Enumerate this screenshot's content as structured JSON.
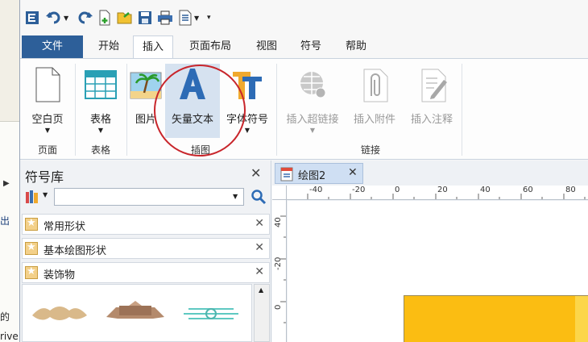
{
  "colors": {
    "file_tab": "#2d5f99",
    "highlight_circle": "#c8252b",
    "page_fill": "#fbbd12"
  },
  "background": {
    "text1": "出",
    "text2": "的",
    "text3": "rive"
  },
  "qat": {
    "icons": [
      "app-logo-icon",
      "undo-icon",
      "redo-icon",
      "new-icon",
      "open-icon",
      "save-icon",
      "print-icon",
      "export-icon",
      "customize-icon"
    ]
  },
  "tabs": [
    {
      "label": "文件"
    },
    {
      "label": "开始"
    },
    {
      "label": "插入"
    },
    {
      "label": "页面布局"
    },
    {
      "label": "视图"
    },
    {
      "label": "符号"
    },
    {
      "label": "帮助"
    }
  ],
  "ribbon": {
    "blank_page": "空白页",
    "table": "表格",
    "picture": "图片",
    "vector_text": "矢量文本",
    "font_symbol": "字体符号",
    "hyperlink": "插入超链接",
    "attachment": "插入附件",
    "annotation": "插入注释",
    "groups": {
      "page": "页面",
      "table": "表格",
      "illustration": "插图",
      "link": "链接"
    }
  },
  "symbol_library": {
    "title": "符号库",
    "search_value": "",
    "items": [
      {
        "name": "常用形状"
      },
      {
        "name": "基本绘图形状"
      },
      {
        "name": "装饰物"
      }
    ]
  },
  "document": {
    "tab_name": "绘图2",
    "ruler_h": [
      "-40",
      "-20",
      "0",
      "20",
      "40",
      "60",
      "80"
    ],
    "ruler_v": [
      "40",
      "-20",
      "0"
    ]
  }
}
